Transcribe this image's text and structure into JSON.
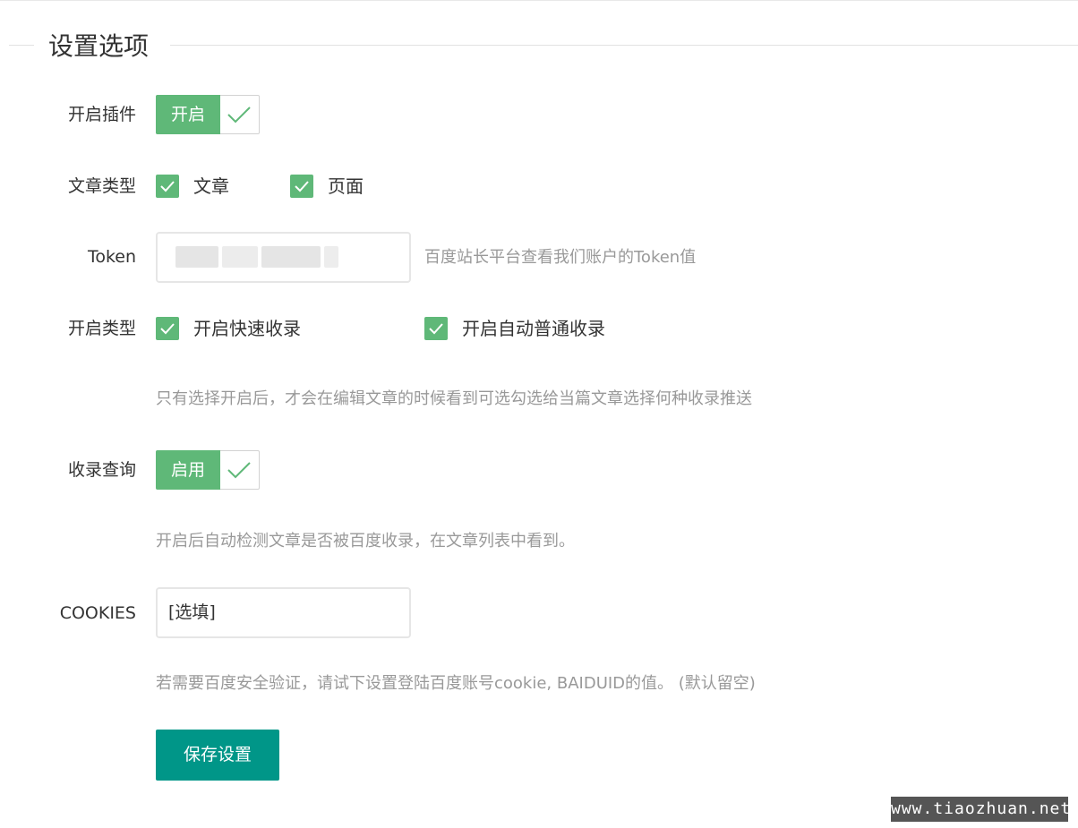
{
  "legend": "设置选项",
  "plugin": {
    "label": "开启插件",
    "switch_text": "开启"
  },
  "post_type": {
    "label": "文章类型",
    "options": [
      {
        "label": "文章",
        "checked": true
      },
      {
        "label": "页面",
        "checked": true
      }
    ]
  },
  "token": {
    "label": "Token",
    "hint": "百度站长平台查看我们账户的Token值"
  },
  "submit_type": {
    "label": "开启类型",
    "options": [
      {
        "label": "开启快速收录",
        "checked": true
      },
      {
        "label": "开启自动普通收录",
        "checked": true
      }
    ],
    "hint": "只有选择开启后，才会在编辑文章的时候看到可选勾选给当篇文章选择何种收录推送"
  },
  "index_query": {
    "label": "收录查询",
    "switch_text": "启用",
    "hint": "开启后自动检测文章是否被百度收录，在文章列表中看到。"
  },
  "cookies": {
    "label": "COOKIES",
    "value": "[选填]",
    "hint": "若需要百度安全验证，请试下设置登陆百度账号cookie, BAIDUID的值。 (默认留空)"
  },
  "save_button": "保存设置",
  "watermark": "www.tiaozhuan.net",
  "colors": {
    "accent_green": "#5fb878",
    "button_teal": "#009688",
    "hint_gray": "#999999"
  }
}
